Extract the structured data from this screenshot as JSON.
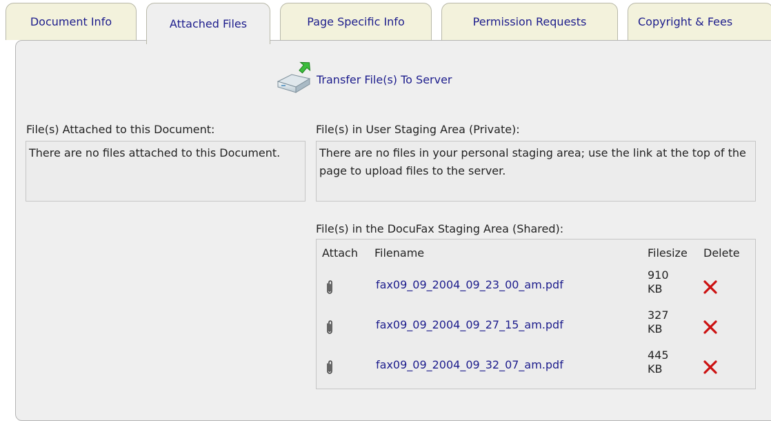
{
  "tabs": [
    {
      "label": "Document Info",
      "active": false
    },
    {
      "label": "Attached Files",
      "active": true
    },
    {
      "label": "Page Specific Info",
      "active": false
    },
    {
      "label": "Permission Requests",
      "active": false
    },
    {
      "label": "Copyright & Fees",
      "active": false
    }
  ],
  "transfer": {
    "label": "Transfer File(s) To Server",
    "icon": "upload-drive-icon"
  },
  "attached": {
    "heading": "File(s) Attached to this Document:",
    "empty_text": "There are no files attached to this Document."
  },
  "user_staging": {
    "heading": "File(s) in User Staging Area (Private):",
    "empty_text": "There are no files in your personal staging area; use the link at the top of the page to upload files to the server."
  },
  "shared_staging": {
    "heading": "File(s) in the DocuFax Staging Area (Shared):",
    "columns": {
      "attach": "Attach",
      "filename": "Filename",
      "filesize": "Filesize",
      "delete": "Delete"
    },
    "files": [
      {
        "filename": "fax09_09_2004_09_23_00_am.pdf",
        "size_value": "910",
        "size_unit": "KB"
      },
      {
        "filename": "fax09_09_2004_09_27_15_am.pdf",
        "size_value": "327",
        "size_unit": "KB"
      },
      {
        "filename": "fax09_09_2004_09_32_07_am.pdf",
        "size_value": "445",
        "size_unit": "KB"
      }
    ],
    "icons": {
      "attach": "paperclip-icon",
      "delete": "delete-x-icon"
    },
    "colors": {
      "delete": "#cc1111",
      "link": "#1c1c8c"
    }
  }
}
